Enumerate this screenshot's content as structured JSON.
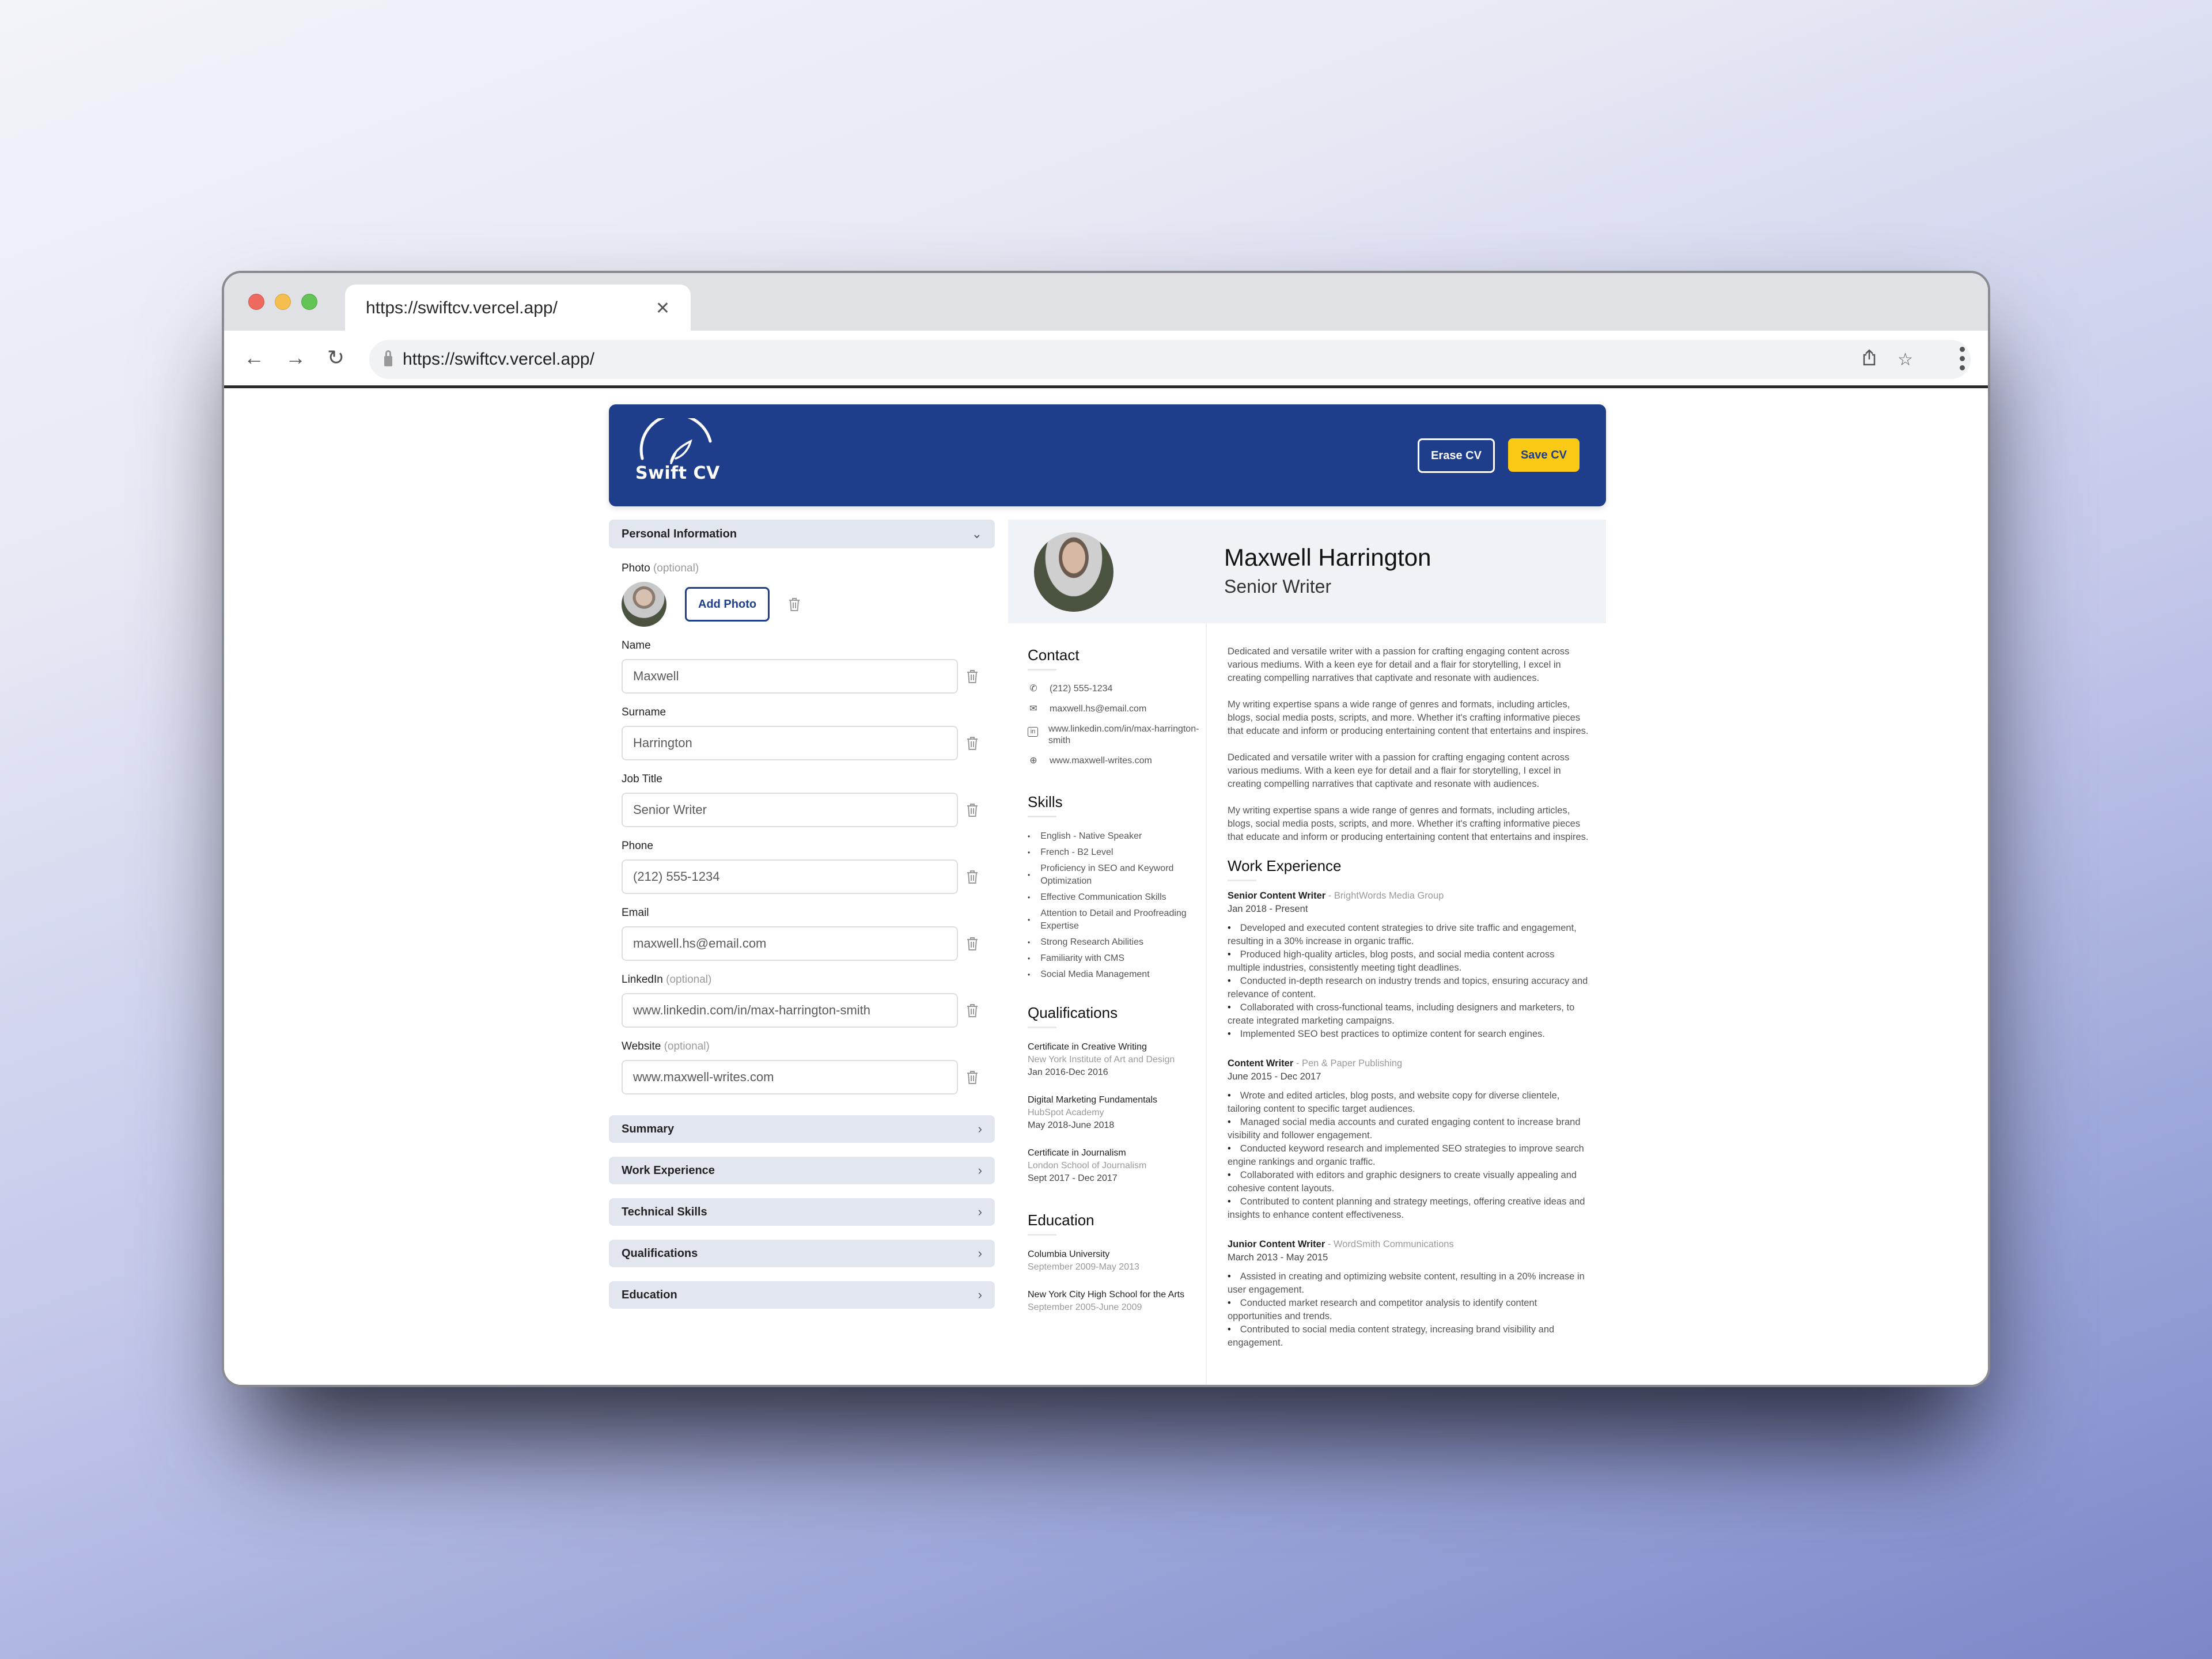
{
  "browser": {
    "tab_title": "https://swiftcv.vercel.app/",
    "url": "https://swiftcv.vercel.app/",
    "icons": {
      "back": "arrow-left-icon",
      "forward": "arrow-right-icon",
      "reload": "reload-icon",
      "lock": "lock-icon",
      "share": "share-icon",
      "bookmark": "star-icon",
      "menu": "kebab-menu-icon",
      "close_tab": "close-icon"
    }
  },
  "app": {
    "logo_text": "Swift CV",
    "erase_label": "Erase CV",
    "save_label": "Save CV",
    "colors": {
      "brand": "#1e3d8a",
      "accent": "#fac915"
    }
  },
  "form": {
    "personal_section_label": "Personal Information",
    "photo_label": "Photo",
    "optional_label": "(optional)",
    "add_photo_label": "Add Photo",
    "fields": [
      {
        "label": "Name",
        "optional": false,
        "value": "Maxwell"
      },
      {
        "label": "Surname",
        "optional": false,
        "value": "Harrington"
      },
      {
        "label": "Job Title",
        "optional": false,
        "value": "Senior Writer"
      },
      {
        "label": "Phone",
        "optional": false,
        "value": "(212) 555-1234"
      },
      {
        "label": "Email",
        "optional": false,
        "value": "maxwell.hs@email.com"
      },
      {
        "label": "LinkedIn",
        "optional": true,
        "value": "www.linkedin.com/in/max-harrington-smith"
      },
      {
        "label": "Website",
        "optional": true,
        "value": "www.maxwell-writes.com"
      }
    ],
    "collapsed_sections": [
      "Summary",
      "Work Experience",
      "Technical Skills",
      "Qualifications",
      "Education"
    ]
  },
  "cv": {
    "name": "Maxwell Harrington",
    "title": "Senior Writer",
    "contact_heading": "Contact",
    "contact": [
      {
        "icon": "phone-icon",
        "text": "(212) 555-1234"
      },
      {
        "icon": "mail-icon",
        "text": "maxwell.hs@email.com"
      },
      {
        "icon": "linkedin-icon",
        "text": "www.linkedin.com/in/max-harrington-smith"
      },
      {
        "icon": "globe-icon",
        "text": "www.maxwell-writes.com"
      }
    ],
    "skills_heading": "Skills",
    "skills": [
      "English - Native Speaker",
      "French - B2 Level",
      "Proficiency in SEO and Keyword Optimization",
      "Effective Communication Skills",
      "Attention to Detail and Proofreading Expertise",
      "Strong Research Abilities",
      "Familiarity with CMS",
      "Social Media Management"
    ],
    "qualifications_heading": "Qualifications",
    "qualifications": [
      {
        "name": "Certificate in Creative Writing",
        "org": "New York Institute of Art and Design",
        "date": "Jan 2016-Dec 2016"
      },
      {
        "name": "Digital Marketing Fundamentals",
        "org": "HubSpot Academy",
        "date": "May 2018-June 2018"
      },
      {
        "name": "Certificate in Journalism",
        "org": "London School of Journalism",
        "date": "Sept 2017 - Dec 2017"
      }
    ],
    "education_heading": "Education",
    "education": [
      {
        "school": "Columbia University",
        "date": "September 2009-May 2013"
      },
      {
        "school": "New York City High School for the Arts",
        "date": "September 2005-June 2009"
      }
    ],
    "summary": [
      "Dedicated and versatile writer with a passion for crafting engaging content across various mediums. With a keen eye for detail and a flair for storytelling, I excel in creating compelling narratives that captivate and resonate with audiences.",
      "My writing expertise spans a wide range of genres and formats, including articles, blogs, social media posts, scripts, and more. Whether it's crafting informative pieces that educate and inform or producing entertaining content that entertains and inspires.",
      "Dedicated and versatile writer with a passion for crafting engaging content across various mediums. With a keen eye for detail and a flair for storytelling, I excel in creating compelling narratives that captivate and resonate with audiences.",
      "My writing expertise spans a wide range of genres and formats, including articles, blogs, social media posts, scripts, and more. Whether it's crafting informative pieces that educate and inform or producing entertaining content that entertains and inspires."
    ],
    "work_heading": "Work Experience",
    "jobs": [
      {
        "role": "Senior Content Writer",
        "company": "BrightWords Media Group",
        "date": "Jan 2018 - Present",
        "bullets": [
          "Developed and executed content strategies to drive site traffic and engagement, resulting in a 30% increase in organic traffic.",
          "Produced high-quality articles, blog posts, and social media content across multiple industries, consistently meeting tight deadlines.",
          "Conducted in-depth research on industry trends and topics, ensuring accuracy and relevance of content.",
          "Collaborated with cross-functional teams, including designers and marketers, to create integrated marketing campaigns.",
          "Implemented SEO best practices to optimize content for search engines."
        ]
      },
      {
        "role": "Content Writer",
        "company": "Pen & Paper Publishing",
        "date": "June 2015 - Dec 2017",
        "bullets": [
          "Wrote and edited articles, blog posts, and website copy for diverse clientele, tailoring content to specific target audiences.",
          "Managed social media accounts and curated engaging content to increase brand visibility and follower engagement.",
          "Conducted keyword research and implemented SEO strategies to improve search engine rankings and organic traffic.",
          "Collaborated with editors and graphic designers to create visually appealing and cohesive content layouts.",
          "Contributed to content planning and strategy meetings, offering creative ideas and insights to enhance content effectiveness."
        ]
      },
      {
        "role": "Junior Content Writer",
        "company": "WordSmith Communications",
        "date": "March 2013 - May 2015",
        "bullets": [
          "Assisted in creating and optimizing website content, resulting in a 20% increase in user engagement.",
          "Conducted market research and competitor analysis to identify content opportunities and trends.",
          "Contributed to social media content strategy, increasing brand visibility and engagement."
        ]
      }
    ]
  }
}
